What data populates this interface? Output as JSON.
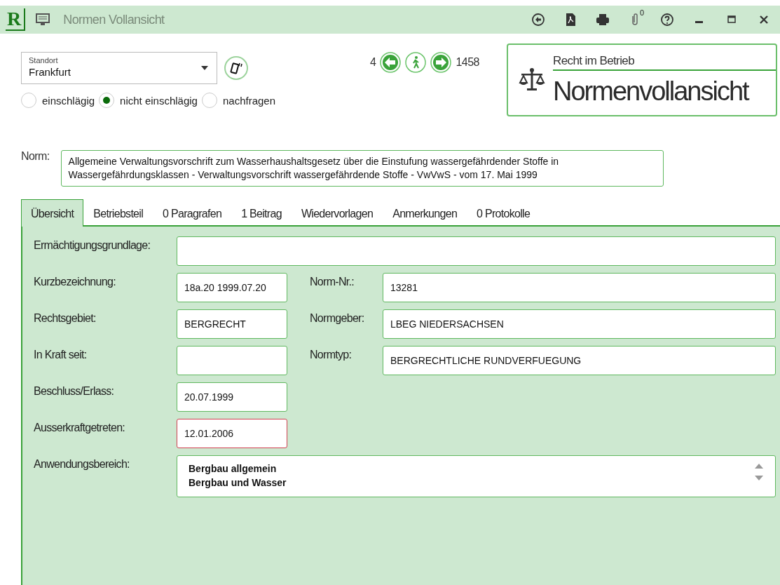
{
  "window": {
    "logo": "R",
    "title": "Normen Vollansicht",
    "attachment_count": "0"
  },
  "standort": {
    "label": "Standort",
    "value": "Frankfurt"
  },
  "relevance": [
    {
      "label": "einschlägig",
      "selected": false
    },
    {
      "label": "nicht einschlägig",
      "selected": true
    },
    {
      "label": "nachfragen",
      "selected": false
    }
  ],
  "navigation": {
    "previous": "4",
    "next": "1458"
  },
  "header_card": {
    "subtitle": "Recht im Betrieb",
    "title": "Normenvollansicht"
  },
  "norm": {
    "label": "Norm:",
    "value": "Allgemeine Verwaltungsvorschrift zum Wasserhaushaltsgesetz über die Einstufung wassergefährdender Stoffe in Wassergefährdungsklassen - Verwaltungsvorschrift wassergefährdende Stoffe - VwVwS - vom 17. Mai 1999"
  },
  "tabs": [
    {
      "label": "Übersicht",
      "selected": true
    },
    {
      "label": "Betriebsteil",
      "selected": false
    },
    {
      "label": "0 Paragrafen",
      "selected": false
    },
    {
      "label": "1 Beitrag",
      "selected": false
    },
    {
      "label": "Wiedervorlagen",
      "selected": false
    },
    {
      "label": "Anmerkungen",
      "selected": false
    },
    {
      "label": "0 Protokolle",
      "selected": false
    }
  ],
  "rows": [
    {
      "kind": "wide",
      "label": "Ermächtigungsgrundlage:",
      "value": ""
    },
    {
      "kind": "pair",
      "label": "Kurzbezeichnung:",
      "value": "18a.20 1999.07.20",
      "error": false,
      "right": {
        "label": "Norm-Nr.:",
        "value": "13281"
      }
    },
    {
      "kind": "pair",
      "label": "Rechtsgebiet:",
      "value": "BERGRECHT",
      "error": false,
      "right": {
        "label": "Normgeber:",
        "value": "LBEG NIEDERSACHSEN"
      }
    },
    {
      "kind": "pair",
      "label": "In Kraft seit:",
      "value": "",
      "error": false,
      "right": {
        "label": "Normtyp:",
        "value": "BERGRECHTLICHE RUNDVERFUEGUNG"
      }
    },
    {
      "kind": "pair",
      "label": "Beschluss/Erlass:",
      "value": "20.07.1999",
      "error": false
    },
    {
      "kind": "pair",
      "label": "Ausserkraftgetreten:",
      "value": "12.01.2006",
      "error": true
    },
    {
      "kind": "list",
      "label": "Anwendungsbereich:",
      "lines": [
        "Bergbau allgemein",
        "Bergbau und Wasser"
      ]
    }
  ]
}
